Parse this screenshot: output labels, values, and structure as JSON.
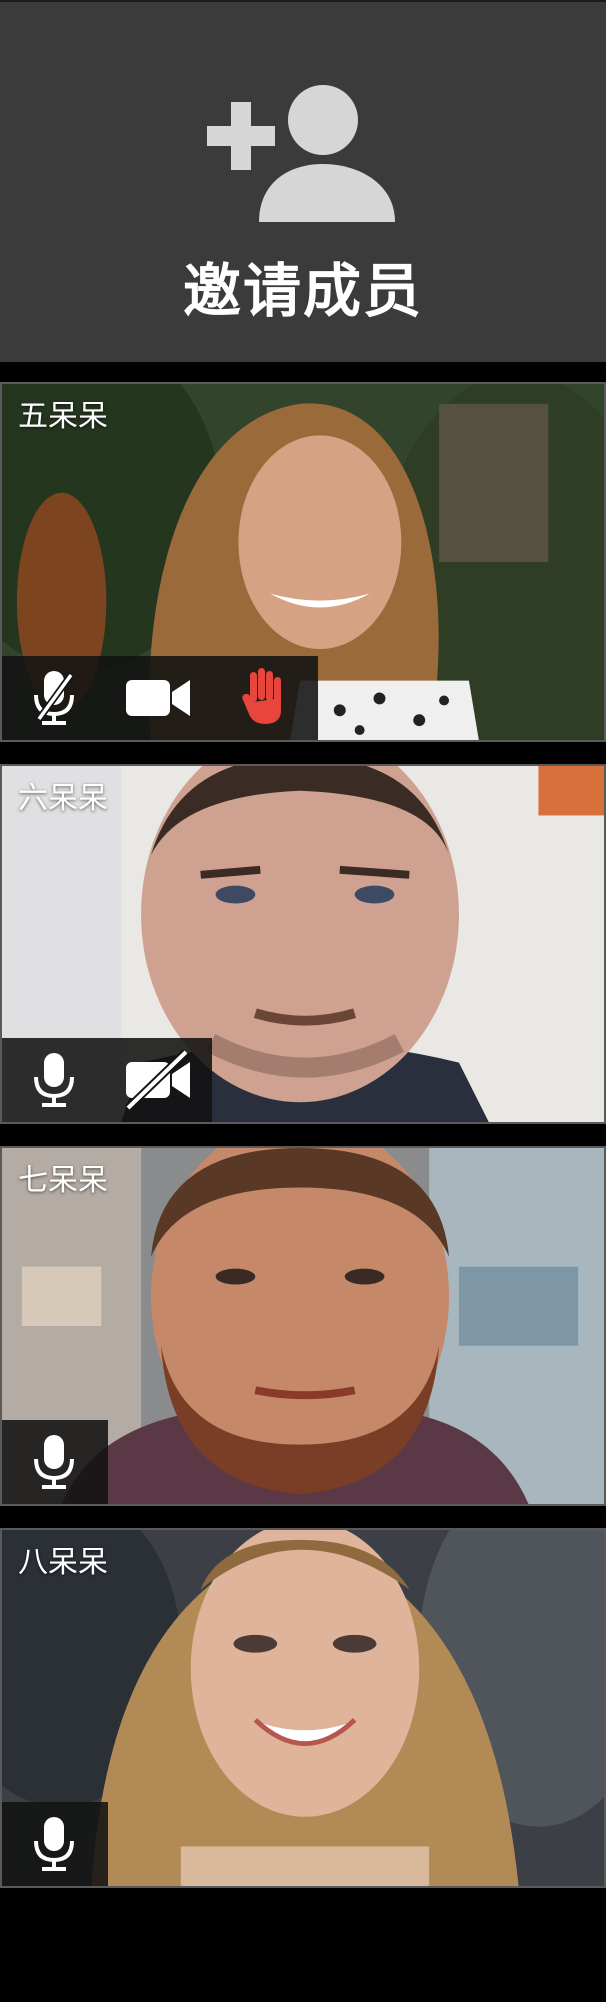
{
  "invite": {
    "label": "邀请成员",
    "icon": "add-person-icon"
  },
  "participants": [
    {
      "name": "五呆呆",
      "controls": [
        {
          "icon": "mic-muted-icon",
          "state": "muted"
        },
        {
          "icon": "camera-icon",
          "state": "on"
        },
        {
          "icon": "raised-hand-icon",
          "state": "raised",
          "color": "#e8453c"
        }
      ]
    },
    {
      "name": "六呆呆",
      "controls": [
        {
          "icon": "mic-icon",
          "state": "on"
        },
        {
          "icon": "camera-off-icon",
          "state": "off"
        }
      ]
    },
    {
      "name": "七呆呆",
      "controls": [
        {
          "icon": "mic-icon",
          "state": "on"
        }
      ]
    },
    {
      "name": "八呆呆",
      "controls": [
        {
          "icon": "mic-icon",
          "state": "on"
        }
      ]
    }
  ],
  "colors": {
    "invite_background": "#3b3b3b",
    "page_background": "#000000",
    "raised_hand": "#e8453c"
  }
}
